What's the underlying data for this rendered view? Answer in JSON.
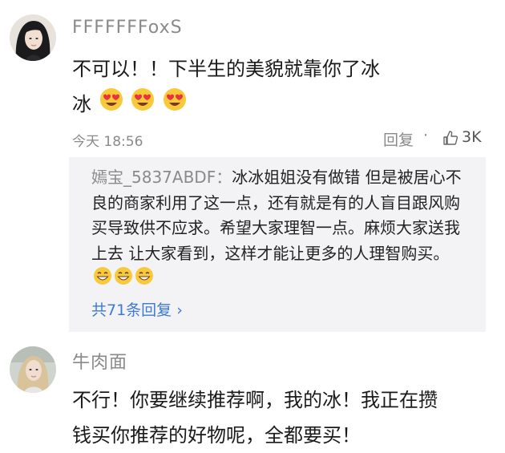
{
  "comments": [
    {
      "username": "FFFFFFFoxS",
      "text_line1": "不可以！！下半生的美貌就靠你了冰",
      "text_line2": "冰",
      "time": "今天 18:56",
      "reply_label": "回复",
      "separator": "·",
      "likes": "3K"
    },
    {
      "username": "牛肉面",
      "text_line1": "不行！你要继续推荐啊，我的冰！我正在攒",
      "text_line2": "钱买你推荐的好物呢，全都要买！"
    }
  ],
  "reply": {
    "author": "嫣宝_5837ABDF：",
    "text": "冰冰姐姐没有做错 但是被居心不良的商家利用了这一点，还有就是有的人盲目跟风购买导致供不应求。希望大家理智一点。麻烦大家送我上去 让大家看到，这样才能让更多的人理智购买。",
    "more_label": "共71条回复",
    "more_arrow": "›"
  },
  "icons": {
    "heart_eyes": "heart-eyes-emoji",
    "grin": "grinning-emoji",
    "like": "thumbs-up-icon"
  },
  "colors": {
    "link": "#3d7ad6",
    "meta": "#8a8a8a",
    "reply_bg": "#f3f3f5"
  }
}
